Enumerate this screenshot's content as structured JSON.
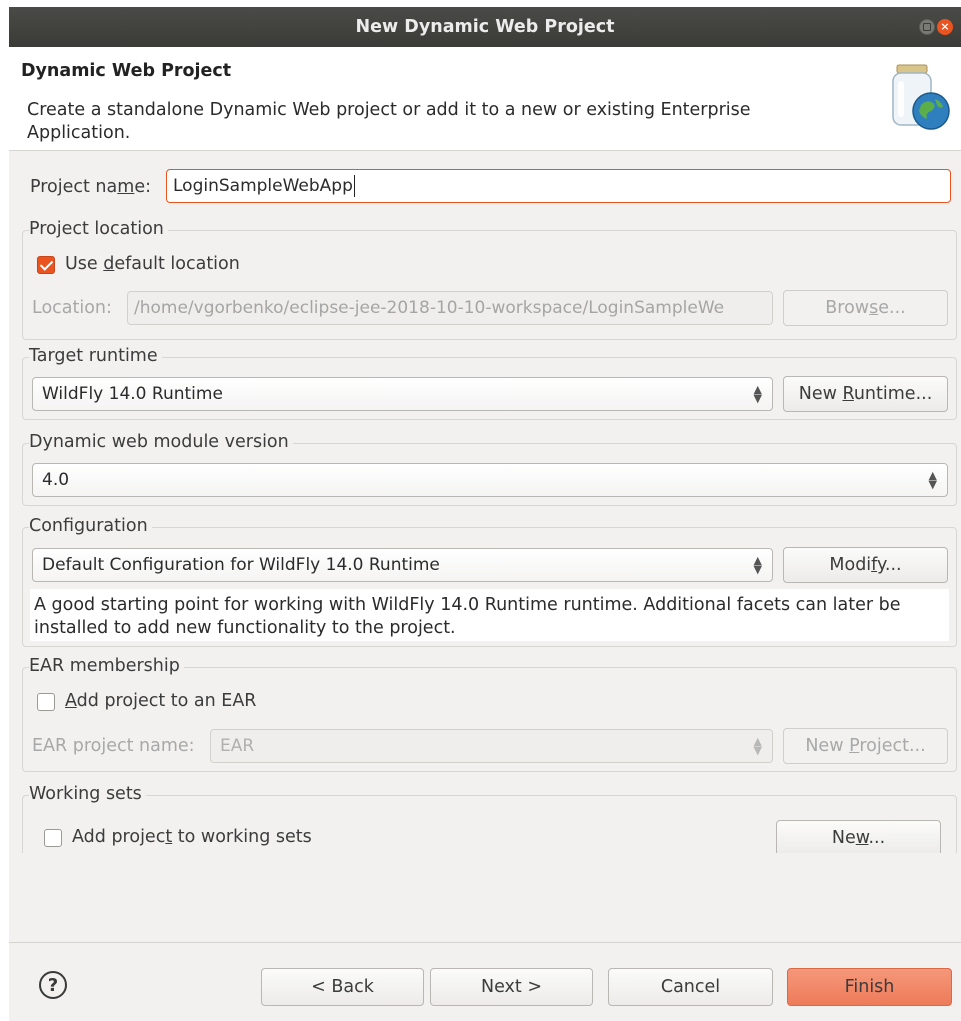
{
  "window": {
    "title": "New Dynamic Web Project"
  },
  "header": {
    "title": "Dynamic Web Project",
    "description": "Create a standalone Dynamic Web project or add it to a new or existing Enterprise Application."
  },
  "project_name": {
    "label_pre": "Project na",
    "label_mn": "m",
    "label_post": "e:",
    "value": "LoginSampleWebApp"
  },
  "project_location": {
    "group_label": "Project location",
    "use_default": {
      "pre": "Use ",
      "mn": "d",
      "post": "efault location",
      "checked": true
    },
    "location_label": "Location:",
    "location_value": "/home/vgorbenko/eclipse-jee-2018-10-10-workspace/LoginSampleWe",
    "browse": {
      "pre": "Brow",
      "mn": "s",
      "post": "e..."
    }
  },
  "target_runtime": {
    "group_label": "Target runtime",
    "selected": "WildFly 14.0 Runtime",
    "new_runtime": {
      "pre": "New ",
      "mn": "R",
      "post": "untime..."
    }
  },
  "module_version": {
    "group_label": "Dynamic web module version",
    "selected": "4.0"
  },
  "configuration": {
    "group_label": "Configuration",
    "selected": "Default Configuration for WildFly 14.0 Runtime",
    "modify": {
      "pre": "Modi",
      "mn": "f",
      "post": "y..."
    },
    "description": "A good starting point for working with WildFly 14.0 Runtime runtime. Additional facets can later be installed to add new functionality to the project."
  },
  "ear": {
    "group_label": "EAR membership",
    "add_to_ear": {
      "pre": "",
      "mn": "A",
      "post": "dd project to an EAR",
      "checked": false
    },
    "name_label": "EAR project name:",
    "name_value": "EAR",
    "new_project": {
      "pre": "New ",
      "mn": "P",
      "post": "roject..."
    }
  },
  "working_sets": {
    "group_label": "Working sets",
    "add": {
      "pre": "Add projec",
      "mn": "t",
      "post": " to working sets",
      "checked": false
    },
    "new": {
      "pre": "Ne",
      "mn": "w",
      "post": "..."
    }
  },
  "footer": {
    "help": "?",
    "back": "< Back",
    "next": "Next >",
    "cancel": "Cancel",
    "finish": "Finish"
  },
  "colors": {
    "accent": "#e95420",
    "finish": "#ee7b59",
    "titlebar": "#3e3e3b"
  },
  "icons": [
    "window-minimize-icon",
    "window-close-icon",
    "project-jar-globe-icon",
    "checkmark-icon",
    "spinner-arrows-icon",
    "help-icon"
  ]
}
